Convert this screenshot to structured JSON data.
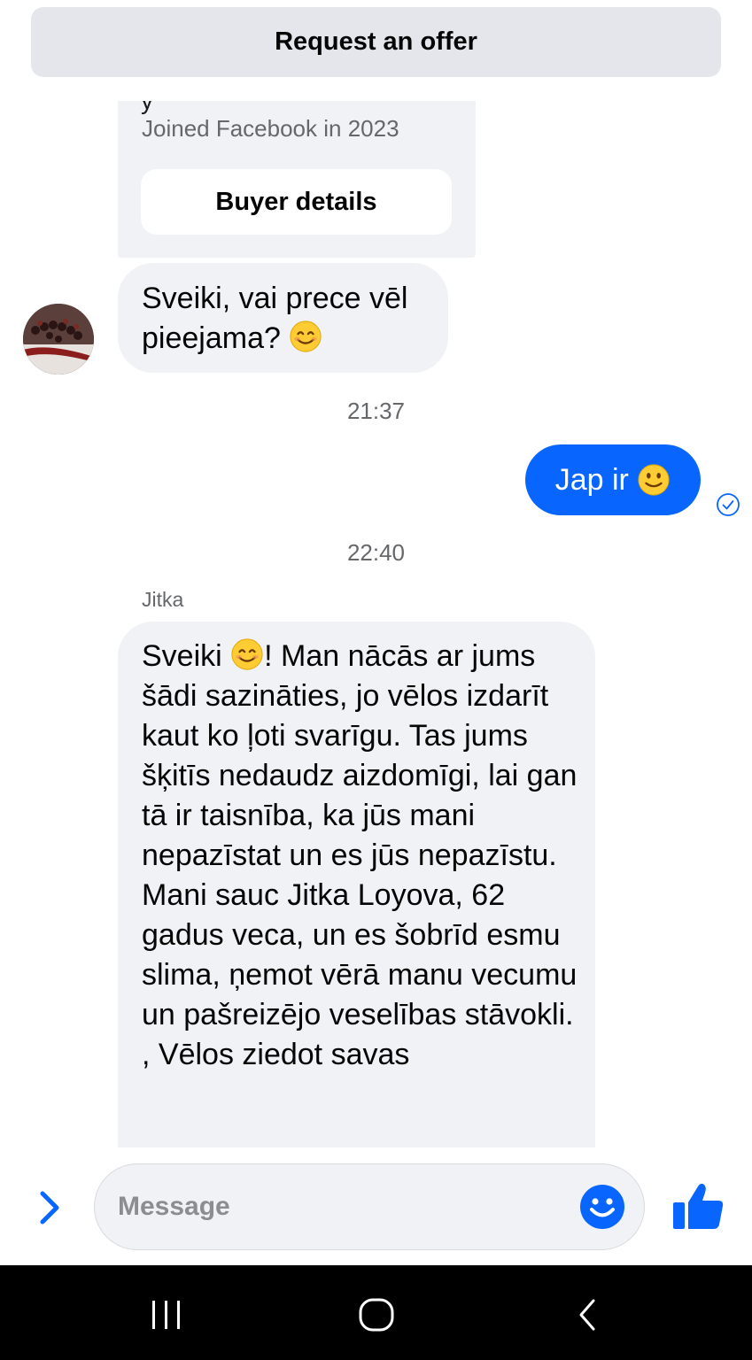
{
  "header": {
    "offer_label": "Request an offer"
  },
  "profile_card": {
    "name_partial": "y",
    "joined": "Joined Facebook in 2023",
    "buyer_details_label": "Buyer details"
  },
  "messages": [
    {
      "direction": "incoming",
      "text": "Sveiki, vai prece vēl pieejama?",
      "emoji": "smiling-face-icon"
    },
    {
      "direction": "timestamp",
      "text": "21:37"
    },
    {
      "direction": "outgoing",
      "text": "Jap ir",
      "emoji": "slightly-smiling-face-icon",
      "status": "sent"
    },
    {
      "direction": "timestamp",
      "text": "22:40"
    },
    {
      "direction": "incoming",
      "sender": "Jitka",
      "text_before_emoji": "Sveiki",
      "text": "! Man nācās ar jums šādi sazināties, jo vēlos izdarīt kaut ko ļoti svarīgu. Tas jums šķitīs nedaudz aizdomīgi, lai gan tā ir taisnība, ka jūs mani nepazīstat un es jūs nepazīstu. Mani sauc Jitka Loyova, 62 gadus veca, un es šobrīd esmu slima, ņemot vērā manu vecumu un pašreizējo veselības stāvokli. , Vēlos ziedot savas",
      "emoji": "smiling-face-icon"
    }
  ],
  "composer": {
    "placeholder": "Message"
  },
  "colors": {
    "accent": "#0866ff",
    "bubble_in": "#f0f2f5",
    "offer_bar": "#e4e6eb"
  },
  "icons": [
    "chevron-right-icon",
    "smiley-icon",
    "thumbs-up-icon",
    "arrow-down-icon",
    "check-circle-icon",
    "recent-apps-icon",
    "home-icon",
    "back-icon"
  ]
}
